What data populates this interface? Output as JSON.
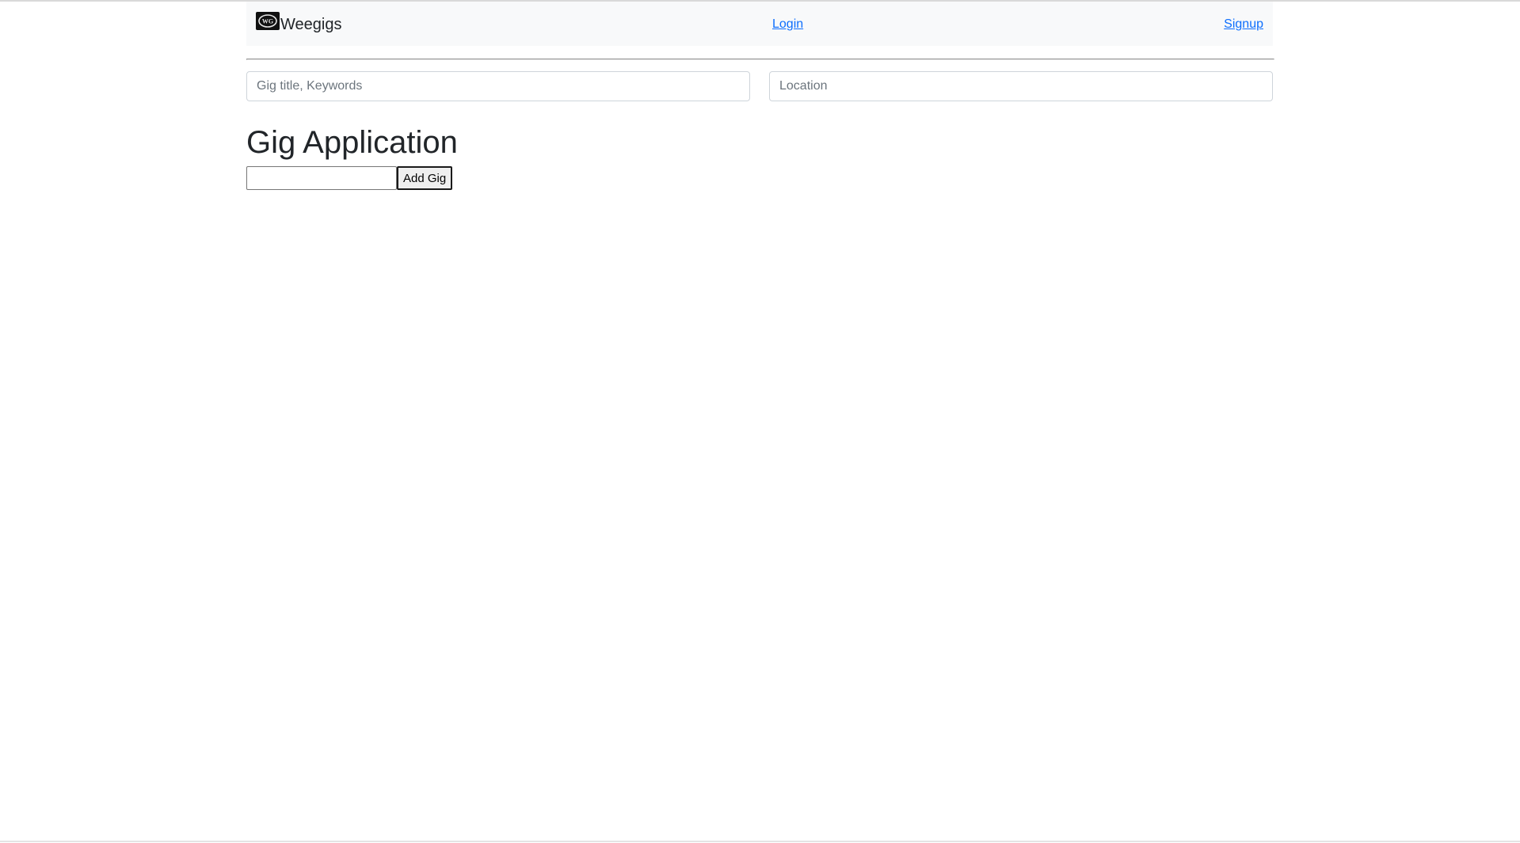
{
  "navbar": {
    "brand_name": "Weegigs",
    "logo_text": "WG",
    "login_label": "Login",
    "signup_label": "Signup"
  },
  "search": {
    "keyword_placeholder": "Gig title, Keywords",
    "keyword_value": "",
    "location_placeholder": "Location",
    "location_value": ""
  },
  "main": {
    "title": "Gig Application",
    "gig_input_value": "",
    "add_gig_label": "Add Gig"
  },
  "colors": {
    "link": "#0d6efd",
    "navbar_bg": "#f8f9fa",
    "text": "#212529"
  }
}
